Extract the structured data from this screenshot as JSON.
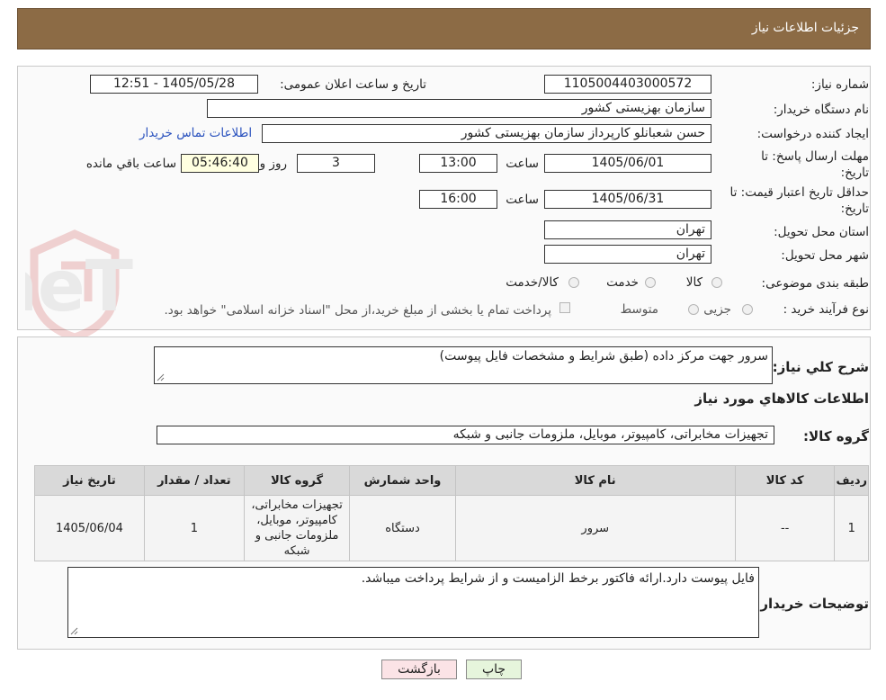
{
  "header": {
    "title": "جزئیات اطلاعات نیاز"
  },
  "details": {
    "need_number_label": "شماره نیاز:",
    "need_number": "1105004403000572",
    "announce_datetime_label": "تاریخ و ساعت اعلان عمومی:",
    "announce_datetime": "1405/05/28 - 12:51",
    "buyer_org_label": "نام دستگاه خریدار:",
    "buyer_org": "سازمان بهزیستی کشور",
    "requester_label": "ایجاد کننده درخواست:",
    "requester": "حسن  شعبانلو کارپرداز سازمان بهزیستی کشور",
    "contact_link": "اطلاعات تماس خریدار",
    "response_deadline_label_1": "مهلت ارسال پاسخ: تا",
    "response_deadline_label_2": "تاریخ:",
    "response_date": "1405/06/01",
    "time_label": "ساعت",
    "response_time": "13:00",
    "days_value": "3",
    "days_label": "روز و",
    "remaining_time": "05:46:40",
    "remaining_label": "ساعت باقي مانده",
    "price_validity_label_1": "حداقل تاریخ اعتبار قیمت: تا",
    "price_validity_label_2": "تاریخ:",
    "price_validity_date": "1405/06/31",
    "price_validity_time": "16:00",
    "delivery_province_label": "استان محل تحویل:",
    "delivery_province": "تهران",
    "delivery_city_label": "شهر محل تحویل:",
    "delivery_city": "تهران",
    "category_label": "طبقه بندی موضوعی:",
    "category_options": [
      "کالا",
      "خدمت",
      "کالا/خدمت"
    ],
    "process_label": "نوع فرآیند خرید :",
    "process_options": [
      "جزیی",
      "متوسط"
    ],
    "payment_note": "پرداخت تمام یا بخشی از مبلغ خرید،از محل \"اسناد خزانه اسلامی\" خواهد بود."
  },
  "need": {
    "summary_label": "شرح کلي نياز:",
    "summary": "سرور جهت مرکز داده (طبق شرایط و مشخصات فایل پیوست)",
    "goods_info_title": "اطلاعات کالاهاي مورد نياز",
    "goods_group_label": "گروه کالا:",
    "goods_group": "تجهیزات مخابراتی، کامپیوتر، موبایل، ملزومات جانبی و شبکه"
  },
  "table": {
    "headers": [
      "رديف",
      "کد کالا",
      "نام کالا",
      "واحد شمارش",
      "گروه کالا",
      "تعداد / مقدار",
      "تاریخ نیاز"
    ],
    "rows": [
      [
        "1",
        "--",
        "سرور",
        "دستگاه",
        "تجهیزات مخابراتی، کامپیوتر، موبایل، ملزومات جانبی و شبکه",
        "1",
        "1405/06/04"
      ]
    ]
  },
  "buyer_notes": {
    "label": "توضيحات خريدار:",
    "text": "فایل پیوست دارد.ارائه فاکتور برخط الزامیست و از شرایط پرداخت میباشد."
  },
  "buttons": {
    "print": "چاپ",
    "back": "بازگشت"
  },
  "watermark": {
    "text": "AriaTender.neT"
  },
  "colors": {
    "header_bg": "#8c6b45",
    "link": "#2a52be",
    "back_button_bg": "#fbe3e6",
    "print_button_bg": "#e6f5dc"
  }
}
